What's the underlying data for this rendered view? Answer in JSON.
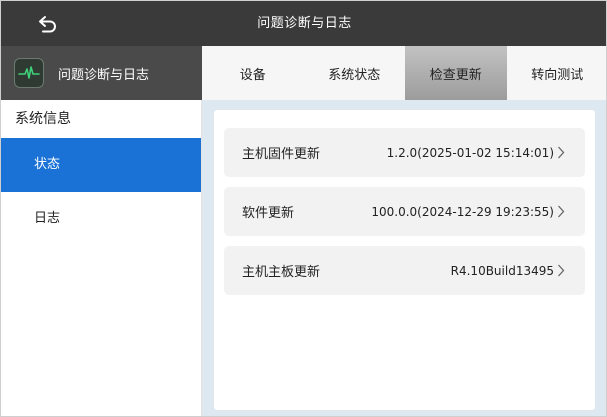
{
  "titlebar": {
    "title": "问题诊断与日志"
  },
  "app": {
    "title": "问题诊断与日志"
  },
  "tabs": [
    {
      "label": "设备",
      "active": false
    },
    {
      "label": "系统状态",
      "active": false
    },
    {
      "label": "检查更新",
      "active": true
    },
    {
      "label": "转向测试",
      "active": false
    }
  ],
  "sidebar": {
    "heading": "系统信息",
    "items": [
      {
        "label": "状态",
        "active": true
      },
      {
        "label": "日志",
        "active": false
      }
    ]
  },
  "updates": [
    {
      "label": "主机固件更新",
      "value": "1.2.0(2025-01-02 15:14:01)"
    },
    {
      "label": "软件更新",
      "value": "100.0.0(2024-12-29 19:23:55)"
    },
    {
      "label": "主机主板更新",
      "value": "R4.10Build13495"
    }
  ],
  "colors": {
    "titlebar_bg": "#3a3a3a",
    "active_sidebar": "#1a72d6",
    "content_bg": "#dde8f1",
    "active_tab": "#a9a9a9"
  }
}
